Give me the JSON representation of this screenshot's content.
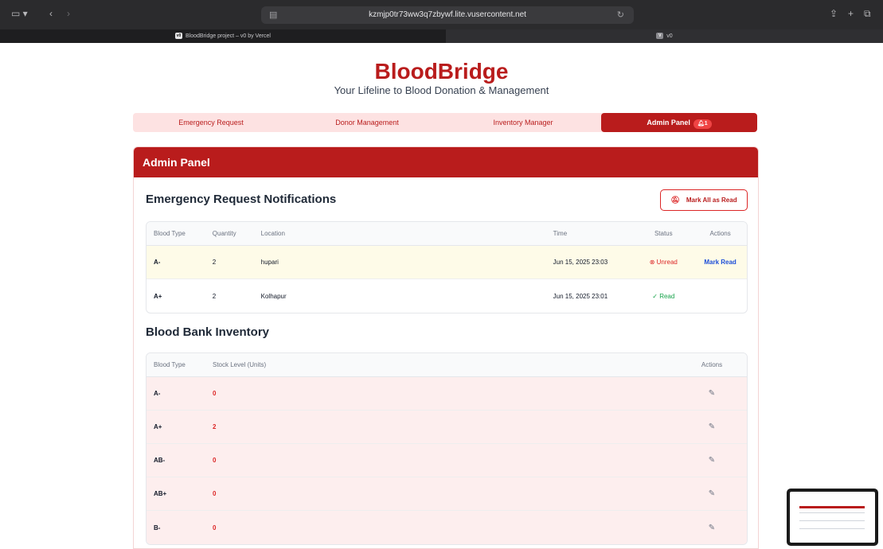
{
  "browser": {
    "url": "kzmjp0tr73ww3q7zbywf.lite.vusercontent.net",
    "tabs": [
      {
        "label": "BloodBridge project – v0 by Vercel"
      },
      {
        "label": "v0"
      }
    ]
  },
  "app": {
    "brand": "BloodBridge",
    "tagline": "Your Lifeline to Blood Donation & Management"
  },
  "nav": {
    "items": [
      {
        "label": "Emergency Request"
      },
      {
        "label": "Donor Management"
      },
      {
        "label": "Inventory Manager"
      },
      {
        "label": "Admin Panel",
        "badge": "1"
      }
    ]
  },
  "panel": {
    "title": "Admin Panel"
  },
  "notifications": {
    "title": "Emergency Request Notifications",
    "mark_all_label": "Mark All as Read",
    "headers": {
      "blood_type": "Blood Type",
      "quantity": "Quantity",
      "location": "Location",
      "time": "Time",
      "status": "Status",
      "actions": "Actions"
    },
    "rows": [
      {
        "blood_type": "A-",
        "quantity": "2",
        "location": "hupari",
        "time": "Jun 15, 2025 23:03",
        "status": "Unread",
        "action": "Mark Read"
      },
      {
        "blood_type": "A+",
        "quantity": "2",
        "location": "Kolhapur",
        "time": "Jun 15, 2025 23:01",
        "status": "Read",
        "action": ""
      }
    ]
  },
  "inventory": {
    "title": "Blood Bank Inventory",
    "headers": {
      "blood_type": "Blood Type",
      "stock": "Stock Level (Units)",
      "actions": "Actions"
    },
    "rows": [
      {
        "blood_type": "A-",
        "stock": "0"
      },
      {
        "blood_type": "A+",
        "stock": "2"
      },
      {
        "blood_type": "AB-",
        "stock": "0"
      },
      {
        "blood_type": "AB+",
        "stock": "0"
      },
      {
        "blood_type": "B-",
        "stock": "0"
      }
    ]
  },
  "colors": {
    "brand": "#b91c1c",
    "nav_bg": "#fde2e2",
    "unread": "#dc2626",
    "read": "#16a34a",
    "link": "#1d4ed8"
  },
  "icons": {
    "sidebar_toggle": "sidebar-icon",
    "back": "chevron-left-icon",
    "forward": "chevron-right-icon",
    "share": "share-icon",
    "new_tab": "plus-icon",
    "tabs_overview": "tabs-icon",
    "bell_off": "bell-off-icon",
    "edit": "edit-icon"
  }
}
